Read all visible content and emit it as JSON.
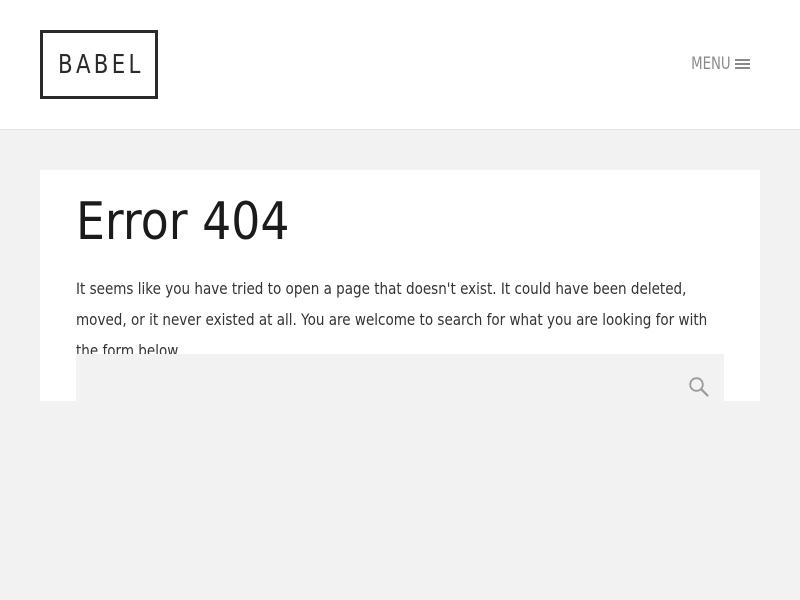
{
  "header": {
    "logo_text": "BABEL",
    "menu_label": "MENU",
    "menu_icon": "hamburger-icon"
  },
  "main": {
    "title": "Error 404",
    "description": "It seems like you have tried to open a page that doesn't exist. It could have been deleted, moved, or it never existed at all. You are welcome to search for what you are looking for with the form below.",
    "search": {
      "value": "",
      "placeholder": "",
      "icon": "search-icon"
    }
  },
  "colors": {
    "page_background": "#f2f2f2",
    "card_background": "#ffffff",
    "text": "#1b1b1b",
    "muted": "#8a8a8a"
  }
}
